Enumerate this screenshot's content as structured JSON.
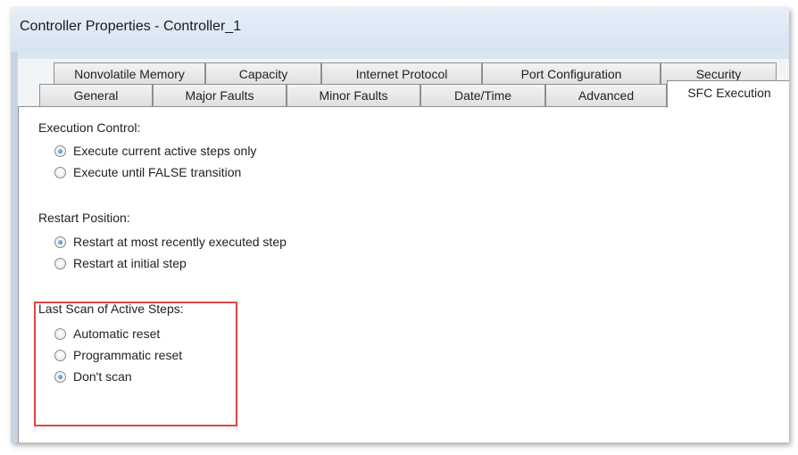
{
  "window": {
    "title": "Controller Properties - Controller_1"
  },
  "tabs": {
    "back_row": [
      "Nonvolatile Memory",
      "Capacity",
      "Internet Protocol",
      "Port Configuration",
      "Security"
    ],
    "front_row": [
      "General",
      "Major Faults",
      "Minor Faults",
      "Date/Time",
      "Advanced",
      "SFC Execution"
    ]
  },
  "execution_control": {
    "label": "Execution Control:",
    "options": [
      "Execute current active steps only",
      "Execute until FALSE transition"
    ],
    "selected": "Execute current active steps only"
  },
  "restart_position": {
    "label": "Restart Position:",
    "options": [
      "Restart at most recently executed step",
      "Restart at initial step"
    ],
    "selected": "Restart at most recently executed step"
  },
  "last_scan": {
    "label": "Last Scan of Active Steps:",
    "options": [
      "Automatic reset",
      "Programmatic reset",
      "Don't scan"
    ],
    "selected": "Don't scan"
  },
  "colors": {
    "highlight": "#e04545",
    "window_frame": "#dbe6f3",
    "panel": "#ffffff"
  }
}
